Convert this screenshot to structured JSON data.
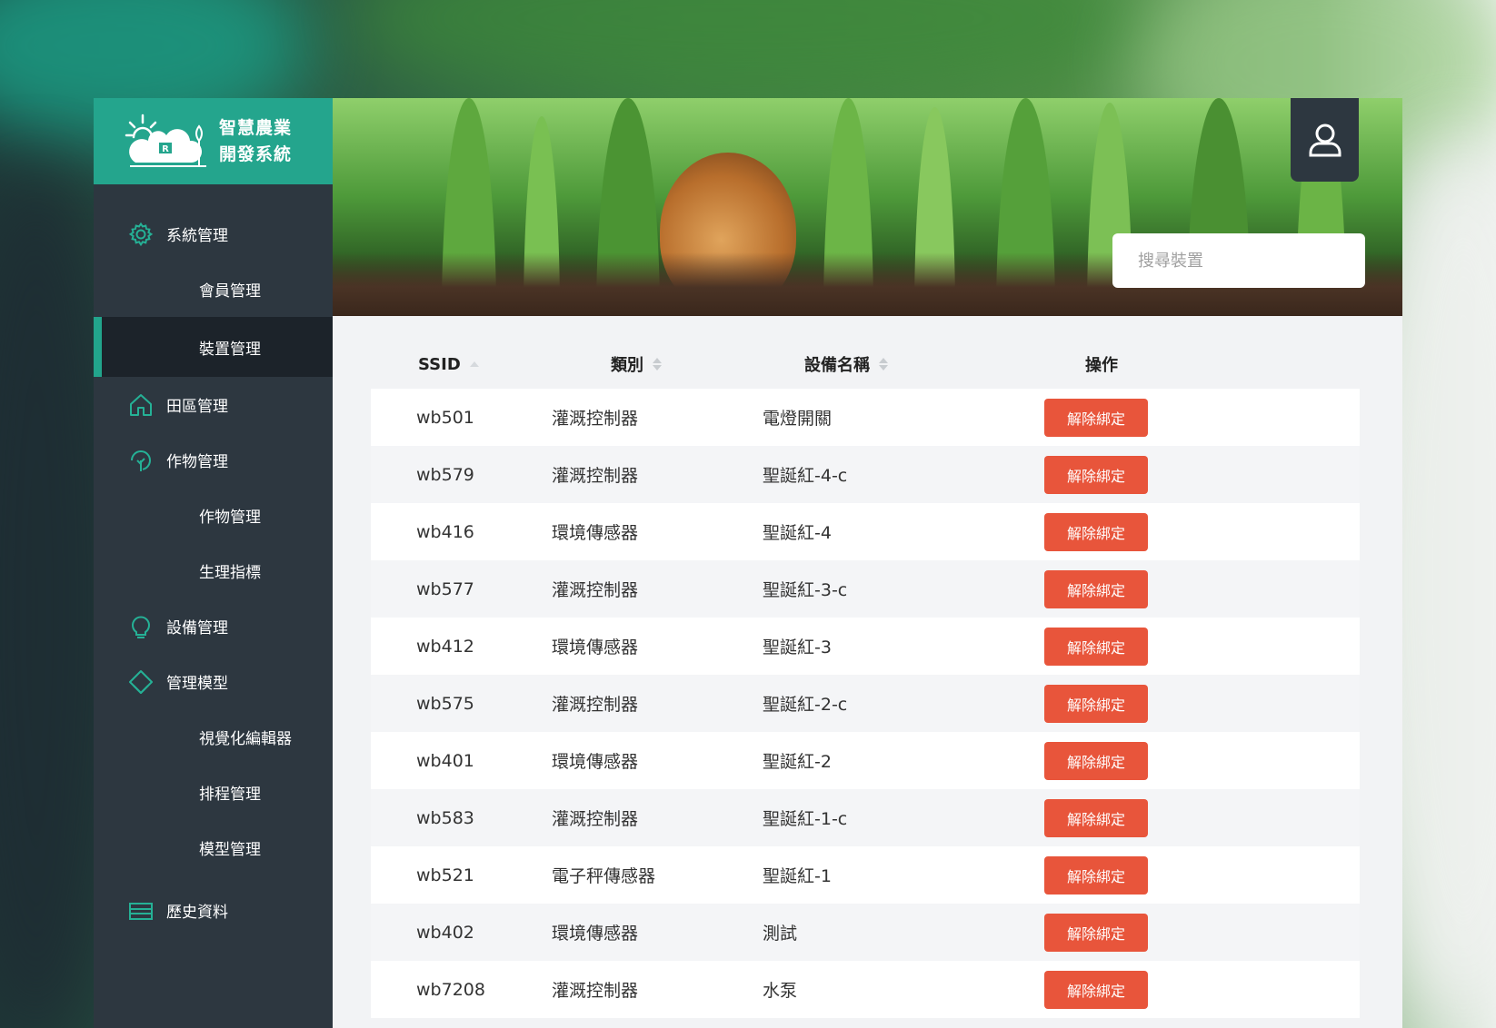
{
  "brand": {
    "line1": "智慧農業",
    "line2": "開發系統"
  },
  "sidebar": {
    "items": [
      {
        "label": "系統管理",
        "icon": "gear-icon"
      },
      {
        "label": "會員管理"
      },
      {
        "label": "裝置管理",
        "active": true
      },
      {
        "label": "田區管理",
        "icon": "home-icon"
      },
      {
        "label": "作物管理",
        "icon": "leaf-icon"
      },
      {
        "label": "作物管理"
      },
      {
        "label": "生理指標"
      },
      {
        "label": "設備管理",
        "icon": "lightbulb-icon"
      },
      {
        "label": "管理模型",
        "icon": "diamond-icon"
      },
      {
        "label": "視覺化編輯器"
      },
      {
        "label": "排程管理"
      },
      {
        "label": "模型管理"
      },
      {
        "label": "歷史資料",
        "icon": "list-icon"
      }
    ]
  },
  "header": {
    "search_placeholder": "搜尋裝置",
    "user_icon": "user-icon"
  },
  "table": {
    "columns": [
      "SSID",
      "類別",
      "設備名稱",
      "操作"
    ],
    "action_label": "解除綁定",
    "rows": [
      {
        "ssid": "wb501",
        "type": "灌溉控制器",
        "name": "電燈開關"
      },
      {
        "ssid": "wb579",
        "type": "灌溉控制器",
        "name": "聖誕紅-4-c"
      },
      {
        "ssid": "wb416",
        "type": "環境傳感器",
        "name": "聖誕紅-4"
      },
      {
        "ssid": "wb577",
        "type": "灌溉控制器",
        "name": "聖誕紅-3-c"
      },
      {
        "ssid": "wb412",
        "type": "環境傳感器",
        "name": "聖誕紅-3"
      },
      {
        "ssid": "wb575",
        "type": "灌溉控制器",
        "name": "聖誕紅-2-c"
      },
      {
        "ssid": "wb401",
        "type": "環境傳感器",
        "name": "聖誕紅-2"
      },
      {
        "ssid": "wb583",
        "type": "灌溉控制器",
        "name": "聖誕紅-1-c"
      },
      {
        "ssid": "wb521",
        "type": "電子秤傳感器",
        "name": "聖誕紅-1"
      },
      {
        "ssid": "wb402",
        "type": "環境傳感器",
        "name": "測試"
      },
      {
        "ssid": "wb7208",
        "type": "灌溉控制器",
        "name": "水泵"
      }
    ]
  },
  "colors": {
    "accent": "#24a58d",
    "sidebar": "#2d3740",
    "danger": "#e8553b"
  }
}
